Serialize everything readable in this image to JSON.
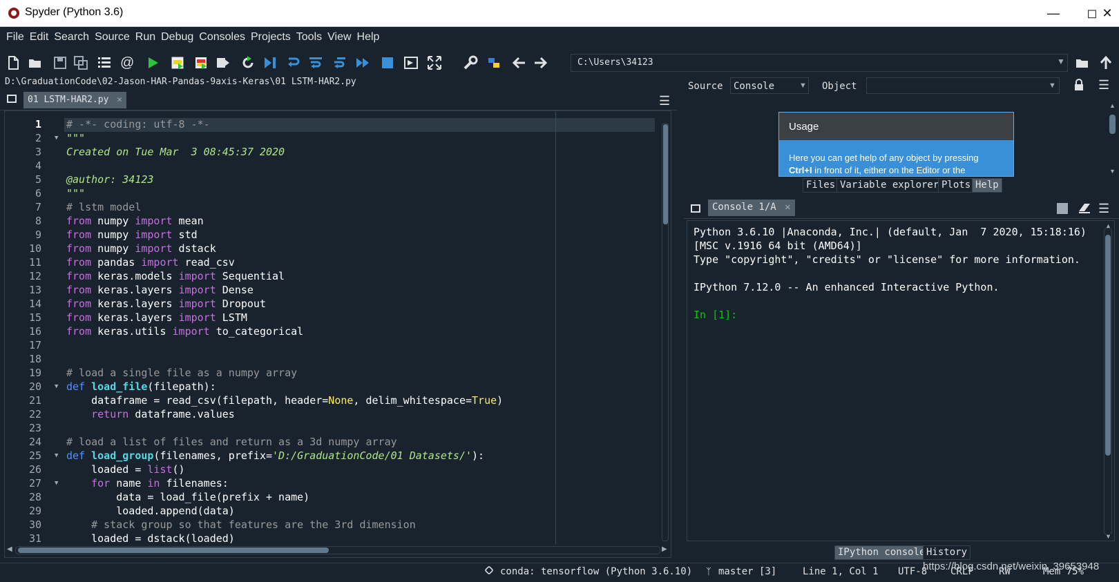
{
  "window": {
    "title": "Spyder (Python 3.6)"
  },
  "menu": [
    "File",
    "Edit",
    "Search",
    "Source",
    "Run",
    "Debug",
    "Consoles",
    "Projects",
    "Tools",
    "View",
    "Help"
  ],
  "toolbar": {
    "path": "C:\\Users\\34123"
  },
  "editor": {
    "filepath": "D:\\GraduationCode\\02-Jason-HAR-Pandas-9axis-Keras\\01 LSTM-HAR2.py",
    "tab_label": "01 LSTM-HAR2.py",
    "lines": [
      "# -*- coding: utf-8 -*-",
      "\"\"\"",
      "Created on Tue Mar  3 08:45:37 2020",
      "",
      "@author: 34123",
      "\"\"\"",
      "# lstm model",
      "from numpy import mean",
      "from numpy import std",
      "from numpy import dstack",
      "from pandas import read_csv",
      "from keras.models import Sequential",
      "from keras.layers import Dense",
      "from keras.layers import Dropout",
      "from keras.layers import LSTM",
      "from keras.utils import to_categorical",
      "",
      "",
      "# load a single file as a numpy array",
      "def load_file(filepath):",
      "    dataframe = read_csv(filepath, header=None, delim_whitespace=True)",
      "    return dataframe.values",
      "",
      "# load a list of files and return as a 3d numpy array",
      "def load_group(filenames, prefix='D:/GraduationCode/01 Datasets/'):",
      "    loaded = list()",
      "    for name in filenames:",
      "        data = load_file(prefix + name)",
      "        loaded.append(data)",
      "    # stack group so that features are the 3rd dimension",
      "    loaded = dstack(loaded)"
    ],
    "line_numbers": [
      "1",
      "2",
      "3",
      "4",
      "5",
      "6",
      "7",
      "8",
      "9",
      "10",
      "11",
      "12",
      "13",
      "14",
      "15",
      "16",
      "17",
      "18",
      "19",
      "20",
      "21",
      "22",
      "23",
      "24",
      "25",
      "26",
      "27",
      "28",
      "29",
      "30",
      "31"
    ]
  },
  "help": {
    "source_label": "Source",
    "source_value": "Console",
    "object_label": "Object",
    "usage_title": "Usage",
    "usage_text_1": "Here you can get help of any object by pressing",
    "usage_text_2_bold": "Ctrl+I",
    "usage_text_2_rest": " in front of it, either on the Editor or the",
    "tabs": [
      "Files",
      "Variable explorer",
      "Plots",
      "Help"
    ],
    "active_tab": "Help"
  },
  "console": {
    "tab_label": "Console 1/A",
    "lines": [
      "Python 3.6.10 |Anaconda, Inc.| (default, Jan  7 2020, 15:18:16)",
      "[MSC v.1916 64 bit (AMD64)]",
      "Type \"copyright\", \"credits\" or \"license\" for more information.",
      "",
      "IPython 7.12.0 -- An enhanced Interactive Python.",
      "",
      "In [1]:"
    ],
    "bottom_tabs": [
      "IPython console",
      "History"
    ],
    "active_bottom_tab": "IPython console"
  },
  "statusbar": {
    "conda": "conda: tensorflow (Python 3.6.10)",
    "git": "master [3]",
    "position": "Line 1, Col 1",
    "encoding": "UTF-8",
    "eol": "CRLF",
    "rw": "RW",
    "mem": "Mem 75%"
  },
  "watermark": "https://blog.csdn.net/weixin_39653948",
  "colors": {
    "background": "#19232d",
    "keyword": "#c670e0",
    "def_keyword": "#558eff",
    "function": "#57d6e4",
    "comment": "#999999",
    "string": "#b0e686",
    "number_constant": "#faed5c",
    "console_prompt": "#00cc00",
    "usage_blue": "#3a8fd9"
  }
}
